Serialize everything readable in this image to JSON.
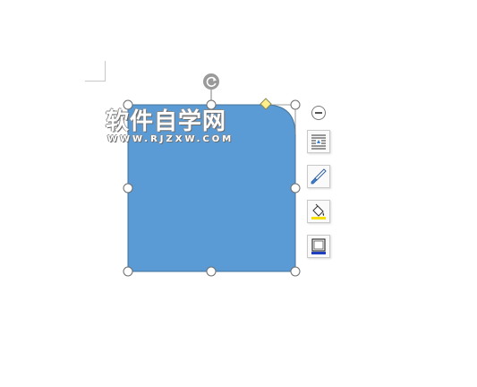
{
  "watermark": {
    "title": "软件自学网",
    "url": "WWW.RJZXW.COM"
  },
  "shape": {
    "fill_color": "#5b9bd5",
    "outline_color": "#41719c",
    "handle_color": "#ffffff",
    "adjust_handle_color": "#ffef8a",
    "rotate_handle_color": "#9a9a9a"
  },
  "layout_options": {
    "icons": [
      "layout-options-icon",
      "shape-styles-icon",
      "shape-fill-icon",
      "shape-outline-icon"
    ],
    "collapse_icon": "minus-circle-icon"
  }
}
